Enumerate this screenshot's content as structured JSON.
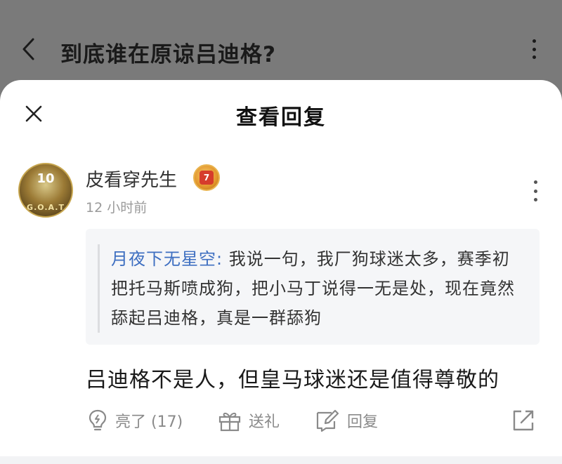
{
  "header": {
    "title": "到底谁在原谅吕迪格?"
  },
  "sheet": {
    "title": "查看回复"
  },
  "comment": {
    "avatar_text": "G.O.A.T",
    "avatar_number": "10",
    "username": "皮看穿先生",
    "timestamp": "12 小时前",
    "quote_author": "月夜下无星空:",
    "quote_text": " 我说一句，我厂狗球迷太多，赛季初把托马斯喷成狗，把小马丁说得一无是处，现在竟然舔起吕迪格，真是一群舔狗",
    "text": "吕迪格不是人，但皇马球迷还是值得尊敬的"
  },
  "actions": {
    "like_label": "亮了 (17)",
    "gift_label": "送礼",
    "reply_label": "回复"
  },
  "icons": {
    "back": "chevron-left-icon",
    "more": "more-vertical-icon",
    "close": "close-icon",
    "like": "lightbulb-icon",
    "gift": "gift-icon",
    "reply": "edit-reply-icon",
    "share": "share-icon"
  },
  "colors": {
    "overlay": "#7a7a7a",
    "quote_author": "#3e6fc1",
    "muted": "#8a8a8a"
  }
}
